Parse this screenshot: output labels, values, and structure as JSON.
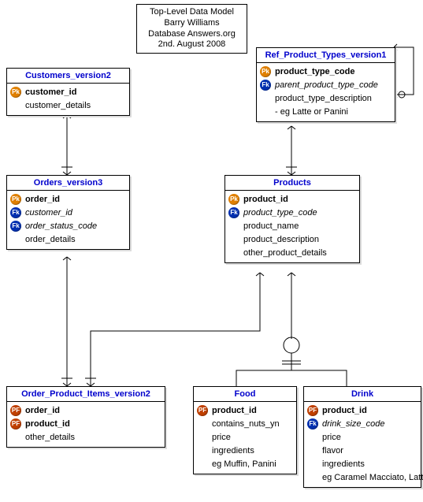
{
  "title_box": {
    "line1": "Top-Level Data Model",
    "line2": "Barry Williams",
    "line3": "Database Answers.org",
    "line4": "2nd. August 2008"
  },
  "entities": {
    "customers": {
      "name": "Customers_version2",
      "attrs": [
        {
          "key": "pk",
          "label": "customer_id",
          "bold": true
        },
        {
          "key": "",
          "label": "customer_details"
        }
      ]
    },
    "ref_product_types": {
      "name": "Ref_Product_Types_version1",
      "attrs": [
        {
          "key": "pk",
          "label": "product_type_code",
          "bold": true
        },
        {
          "key": "fk",
          "label": "parent_product_type_code",
          "italic": true
        },
        {
          "key": "",
          "label": "product_type_description"
        },
        {
          "key": "",
          "label": "- eg Latte or Panini"
        }
      ]
    },
    "orders": {
      "name": "Orders_version3",
      "attrs": [
        {
          "key": "pk",
          "label": "order_id",
          "bold": true
        },
        {
          "key": "fk",
          "label": "customer_id",
          "italic": true
        },
        {
          "key": "fk",
          "label": "order_status_code",
          "italic": true
        },
        {
          "key": "",
          "label": "order_details"
        }
      ]
    },
    "products": {
      "name": "Products",
      "attrs": [
        {
          "key": "pk",
          "label": "product_id",
          "bold": true
        },
        {
          "key": "fk",
          "label": "product_type_code",
          "italic": true
        },
        {
          "key": "",
          "label": "product_name"
        },
        {
          "key": "",
          "label": "product_description"
        },
        {
          "key": "",
          "label": "other_product_details"
        }
      ]
    },
    "order_product_items": {
      "name": "Order_Product_Items_version2",
      "attrs": [
        {
          "key": "pf",
          "label": "order_id",
          "bold": true
        },
        {
          "key": "pf",
          "label": "product_id",
          "bold": true
        },
        {
          "key": "",
          "label": "other_details"
        }
      ]
    },
    "food": {
      "name": "Food",
      "attrs": [
        {
          "key": "pf",
          "label": "product_id",
          "bold": true
        },
        {
          "key": "",
          "label": "contains_nuts_yn"
        },
        {
          "key": "",
          "label": "price"
        },
        {
          "key": "",
          "label": "ingredients"
        },
        {
          "key": "",
          "label": "eg Muffin, Panini"
        }
      ]
    },
    "drink": {
      "name": "Drink",
      "attrs": [
        {
          "key": "pf",
          "label": "product_id",
          "bold": true
        },
        {
          "key": "fk",
          "label": "drink_size_code",
          "italic": true
        },
        {
          "key": "",
          "label": "price"
        },
        {
          "key": "",
          "label": "flavor"
        },
        {
          "key": "",
          "label": "ingredients"
        },
        {
          "key": "",
          "label": "eg Caramel Macciato, Latte"
        }
      ]
    }
  }
}
